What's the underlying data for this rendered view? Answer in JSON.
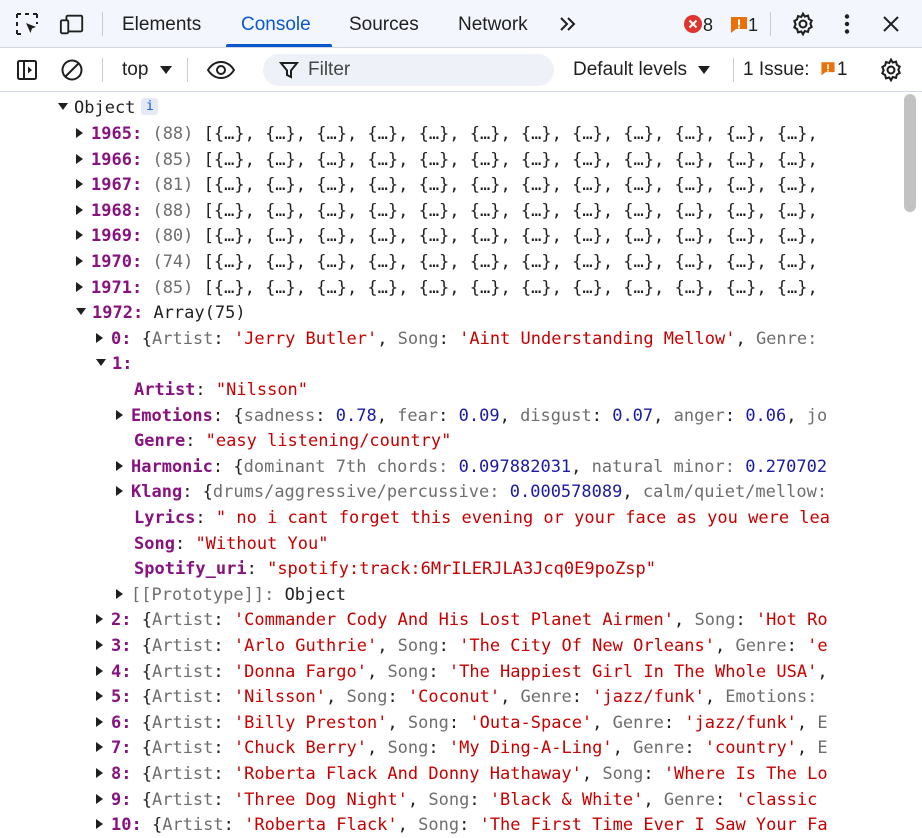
{
  "tabs": [
    {
      "label": "Elements"
    },
    {
      "label": "Console"
    },
    {
      "label": "Sources"
    },
    {
      "label": "Network"
    }
  ],
  "errors_count": "8",
  "warnings_count": "1",
  "toolbar": {
    "context": "top",
    "filter_placeholder": "Filter",
    "levels": "Default levels",
    "issues_label": "1 Issue:",
    "issues_count": "1"
  },
  "colors": {
    "accent": "#0b57d0",
    "error": "#dc362e",
    "warning": "#e8710a",
    "key": "#881280",
    "string": "#c80000",
    "number": "#1a1aa6"
  },
  "console": {
    "root_label": "Object",
    "info_glyph": "i",
    "years": [
      {
        "key": "1965",
        "count": "(88)",
        "preview": "[{…}, {…}, {…}, {…}, {…}, {…}, {…}, {…}, {…}, {…}, {…}, {…},"
      },
      {
        "key": "1966",
        "count": "(85)",
        "preview": "[{…}, {…}, {…}, {…}, {…}, {…}, {…}, {…}, {…}, {…}, {…}, {…},"
      },
      {
        "key": "1967",
        "count": "(81)",
        "preview": "[{…}, {…}, {…}, {…}, {…}, {…}, {…}, {…}, {…}, {…}, {…}, {…},"
      },
      {
        "key": "1968",
        "count": "(88)",
        "preview": "[{…}, {…}, {…}, {…}, {…}, {…}, {…}, {…}, {…}, {…}, {…}, {…},"
      },
      {
        "key": "1969",
        "count": "(80)",
        "preview": "[{…}, {…}, {…}, {…}, {…}, {…}, {…}, {…}, {…}, {…}, {…}, {…},"
      },
      {
        "key": "1970",
        "count": "(74)",
        "preview": "[{…}, {…}, {…}, {…}, {…}, {…}, {…}, {…}, {…}, {…}, {…}, {…},"
      },
      {
        "key": "1971",
        "count": "(85)",
        "preview": "[{…}, {…}, {…}, {…}, {…}, {…}, {…}, {…}, {…}, {…}, {…}, {…},"
      }
    ],
    "expanded_year": {
      "key": "1972",
      "value": "Array(75)"
    },
    "item0": {
      "index": "0",
      "artist": "'Jerry Butler'",
      "song": "'Aint Understanding Mellow'",
      "tail": "Genre:"
    },
    "item1": {
      "index": "1",
      "artist": "\"Nilsson\"",
      "emotions": {
        "sadness": "0.78",
        "fear": "0.09",
        "disgust": "0.07",
        "anger": "0.06",
        "tail": "jo"
      },
      "genre": "\"easy listening/country\"",
      "harmonic": {
        "k1": "dominant 7th chords",
        "v1": "0.097882031",
        "k2": "natural minor",
        "v2": "0.270702"
      },
      "klang": {
        "k1": "drums/aggressive/percussive",
        "v1": "0.000578089",
        "k2": "calm/quiet/mellow:"
      },
      "lyrics": "\" no i cant forget this evening or your face as you were lea",
      "song": "\"Without You\"",
      "spotify_uri": "\"spotify:track:6MrILERJLA3Jcq0E9poZsp\"",
      "prototype": "[[Prototype]]",
      "prototype_value": "Object"
    },
    "items": [
      {
        "index": "2",
        "artist": "'Commander Cody And His Lost Planet Airmen'",
        "song": "'Hot Ro",
        "tail": ""
      },
      {
        "index": "3",
        "artist": "'Arlo Guthrie'",
        "song": "'The City Of New Orleans'",
        "tail": "Genre: 'e"
      },
      {
        "index": "4",
        "artist": "'Donna Fargo'",
        "song": "'The Happiest Girl In The Whole USA'",
        "tail": ""
      },
      {
        "index": "5",
        "artist": "'Nilsson'",
        "song": "'Coconut'",
        "tail": "Genre: 'jazz/funk', Emotions:"
      },
      {
        "index": "6",
        "artist": "'Billy Preston'",
        "song": "'Outa-Space'",
        "tail": "Genre: 'jazz/funk', E"
      },
      {
        "index": "7",
        "artist": "'Chuck Berry'",
        "song": "'My Ding-A-Ling'",
        "tail": "Genre: 'country', E"
      },
      {
        "index": "8",
        "artist": "'Roberta Flack And Donny Hathaway'",
        "song": "'Where Is The Lo",
        "tail": ""
      },
      {
        "index": "9",
        "artist": "'Three Dog Night'",
        "song": "'Black & White'",
        "tail": "Genre: 'classic"
      },
      {
        "index": "10",
        "artist": "'Roberta Flack'",
        "song": "'The First Time Ever I Saw Your Fa",
        "tail": ""
      }
    ]
  }
}
